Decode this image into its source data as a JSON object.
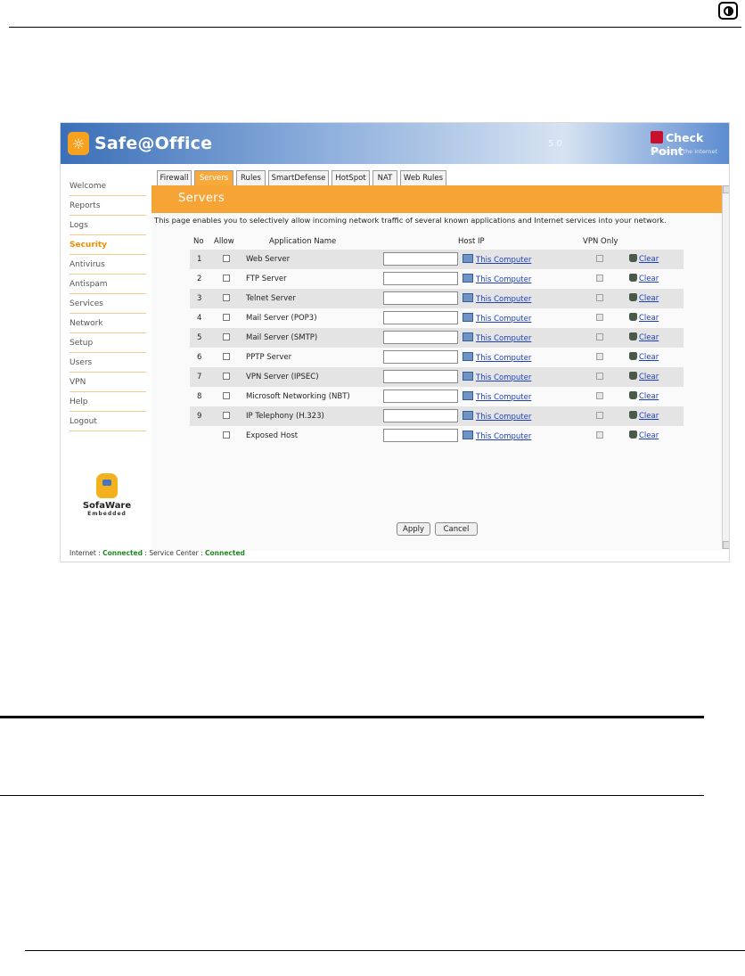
{
  "app": {
    "title": "Safe@Office",
    "version": "5.0",
    "brand": "Check Point",
    "tagline": "We Secure the Internet"
  },
  "sidebar": {
    "items": [
      {
        "label": "Welcome"
      },
      {
        "label": "Reports"
      },
      {
        "label": "Logs"
      },
      {
        "label": "Security",
        "active": true
      },
      {
        "label": "Antivirus"
      },
      {
        "label": "Antispam"
      },
      {
        "label": "Services"
      },
      {
        "label": "Network"
      },
      {
        "label": "Setup"
      },
      {
        "label": "Users"
      },
      {
        "label": "VPN"
      },
      {
        "label": "Help"
      },
      {
        "label": "Logout"
      }
    ],
    "sofaware_name": "SofaWare",
    "sofaware_sub": "Embedded"
  },
  "tabs": [
    {
      "label": "Firewall"
    },
    {
      "label": "Servers",
      "active": true
    },
    {
      "label": "Rules"
    },
    {
      "label": "SmartDefense"
    },
    {
      "label": "HotSpot"
    },
    {
      "label": "NAT"
    },
    {
      "label": "Web Rules"
    }
  ],
  "page": {
    "title": "Servers",
    "description": "This page enables you to selectively allow incoming network traffic of several known applications and Internet services into your network."
  },
  "table": {
    "headers": {
      "no": "No",
      "allow": "Allow",
      "app": "Application Name",
      "host_ip": "Host IP",
      "vpn_only": "VPN Only"
    },
    "this_computer_label": "This Computer",
    "clear_label": "Clear",
    "rows": [
      {
        "no": "1",
        "app": "Web Server",
        "host_ip": ""
      },
      {
        "no": "2",
        "app": "FTP Server",
        "host_ip": ""
      },
      {
        "no": "3",
        "app": "Telnet Server",
        "host_ip": ""
      },
      {
        "no": "4",
        "app": "Mail Server (POP3)",
        "host_ip": ""
      },
      {
        "no": "5",
        "app": "Mail Server (SMTP)",
        "host_ip": ""
      },
      {
        "no": "6",
        "app": "PPTP Server",
        "host_ip": ""
      },
      {
        "no": "7",
        "app": "VPN Server (IPSEC)",
        "host_ip": ""
      },
      {
        "no": "8",
        "app": "Microsoft Networking (NBT)",
        "host_ip": ""
      },
      {
        "no": "9",
        "app": "IP Telephony (H.323)",
        "host_ip": ""
      },
      {
        "no": "",
        "app": "Exposed Host",
        "host_ip": ""
      }
    ]
  },
  "buttons": {
    "apply": "Apply",
    "cancel": "Cancel"
  },
  "status": {
    "internet_label": "Internet :",
    "internet_value": "Connected",
    "service_label": "Service Center :",
    "service_value": "Connected"
  },
  "colors": {
    "accent": "#f7a436",
    "link": "#1d3fbf",
    "connected": "#1f8a1f"
  }
}
